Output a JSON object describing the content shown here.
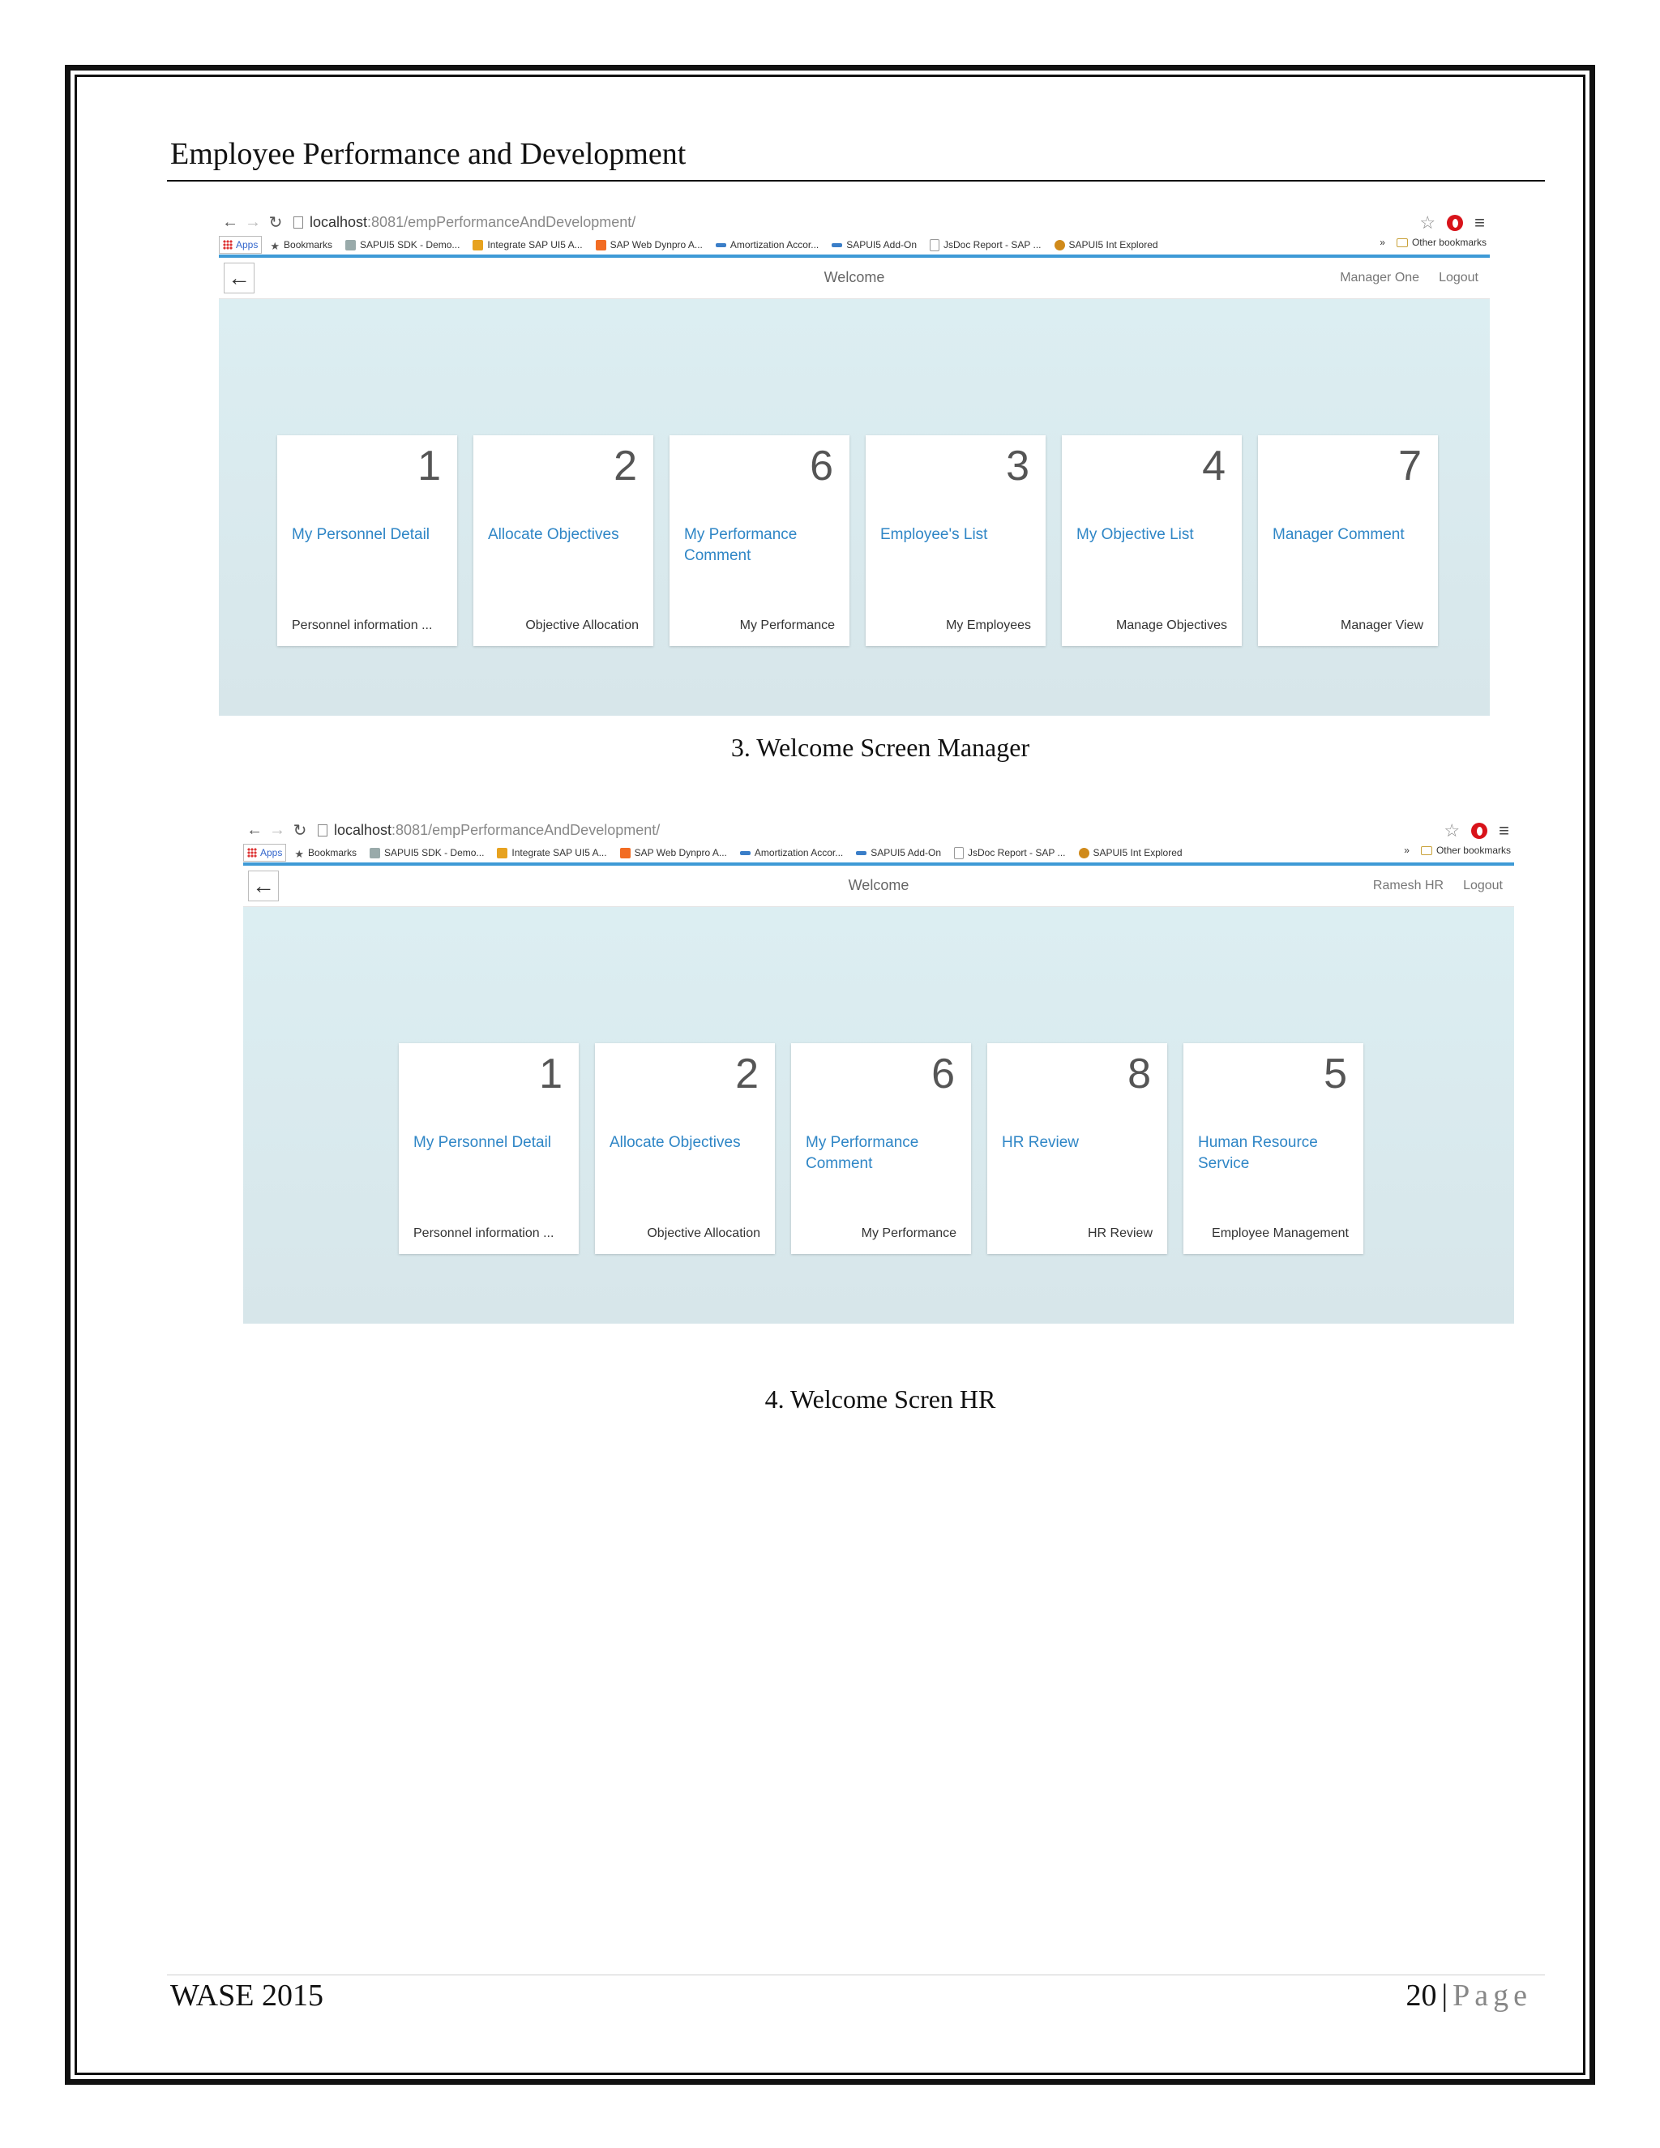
{
  "document": {
    "header": "Employee Performance and Development",
    "footer_left": "WASE 2015",
    "page_number": "20",
    "page_separator": "|",
    "page_word": "Page"
  },
  "screenshots": [
    {
      "caption": "3. Welcome Screen Manager",
      "browser": {
        "url_host": "localhost",
        "url_rest": ":8081/empPerformanceAndDevelopment/",
        "bookmarks": [
          "Apps",
          "Bookmarks",
          "SAPUI5 SDK - Demo...",
          "Integrate SAP UI5 A...",
          "SAP Web Dynpro A...",
          "Amortization Accor...",
          "SAPUI5 Add-On",
          "JsDoc Report - SAP ...",
          "SAPUI5 Int Explored"
        ],
        "overflow": "»",
        "other_bookmarks": "Other bookmarks"
      },
      "app": {
        "title": "Welcome",
        "user": "Manager One",
        "logout": "Logout"
      },
      "tiles": [
        {
          "number": "1",
          "title": "My Personnel Detail",
          "info": "Personnel information ..."
        },
        {
          "number": "2",
          "title": "Allocate Objectives",
          "info": "Objective Allocation"
        },
        {
          "number": "6",
          "title": "My Performance Comment",
          "info": "My Performance"
        },
        {
          "number": "3",
          "title": "Employee's List",
          "info": "My Employees"
        },
        {
          "number": "4",
          "title": "My Objective List",
          "info": "Manage Objectives"
        },
        {
          "number": "7",
          "title": "Manager Comment",
          "info": "Manager View"
        }
      ]
    },
    {
      "caption": "4. Welcome Scren HR",
      "browser": {
        "url_host": "localhost",
        "url_rest": ":8081/empPerformanceAndDevelopment/",
        "bookmarks": [
          "Apps",
          "Bookmarks",
          "SAPUI5 SDK - Demo...",
          "Integrate SAP UI5 A...",
          "SAP Web Dynpro A...",
          "Amortization Accor...",
          "SAPUI5 Add-On",
          "JsDoc Report - SAP ...",
          "SAPUI5 Int Explored"
        ],
        "overflow": "»",
        "other_bookmarks": "Other bookmarks"
      },
      "app": {
        "title": "Welcome",
        "user": "Ramesh HR",
        "logout": "Logout"
      },
      "tiles": [
        {
          "number": "1",
          "title": "My Personnel Detail",
          "info": "Personnel information ..."
        },
        {
          "number": "2",
          "title": "Allocate Objectives",
          "info": "Objective Allocation"
        },
        {
          "number": "6",
          "title": "My Performance Comment",
          "info": "My Performance"
        },
        {
          "number": "8",
          "title": "HR Review",
          "info": "HR Review"
        },
        {
          "number": "5",
          "title": "Human Resource Service",
          "info": "Employee Management"
        }
      ]
    }
  ],
  "colors": {
    "tile_title": "#2f86c6",
    "browser_accent": "#3e9ad6",
    "tile_area": "#dceef2"
  }
}
